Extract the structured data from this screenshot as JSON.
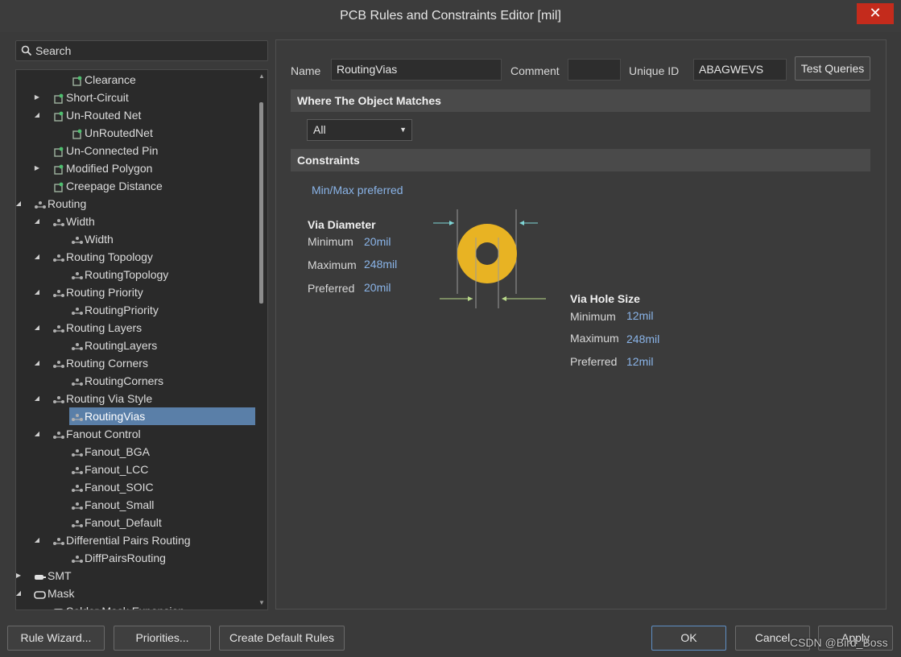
{
  "window": {
    "title": "PCB Rules and Constraints Editor [mil]",
    "close_glyph": "✕"
  },
  "search": {
    "placeholder": "Search"
  },
  "tree": {
    "items": [
      {
        "label": "Clearance",
        "icon": "rule-icon"
      },
      {
        "label": "Short-Circuit",
        "icon": "rule-icon",
        "arrow": "collapsed"
      },
      {
        "label": "Un-Routed Net",
        "icon": "rule-icon",
        "arrow": "expanded"
      },
      {
        "label": "UnRoutedNet",
        "icon": "rule-icon"
      },
      {
        "label": "Un-Connected Pin",
        "icon": "rule-icon"
      },
      {
        "label": "Modified Polygon",
        "icon": "rule-icon",
        "arrow": "collapsed"
      },
      {
        "label": "Creepage Distance",
        "icon": "rule-icon"
      },
      {
        "label": "Routing",
        "icon": "routing-icon",
        "arrow": "expanded"
      },
      {
        "label": "Width",
        "icon": "routing-icon",
        "arrow": "expanded"
      },
      {
        "label": "Width",
        "icon": "routing-icon"
      },
      {
        "label": "Routing Topology",
        "icon": "routing-icon",
        "arrow": "expanded"
      },
      {
        "label": "RoutingTopology",
        "icon": "routing-icon"
      },
      {
        "label": "Routing Priority",
        "icon": "routing-icon",
        "arrow": "expanded"
      },
      {
        "label": "RoutingPriority",
        "icon": "routing-icon"
      },
      {
        "label": "Routing Layers",
        "icon": "routing-icon",
        "arrow": "expanded"
      },
      {
        "label": "RoutingLayers",
        "icon": "routing-icon"
      },
      {
        "label": "Routing Corners",
        "icon": "routing-icon",
        "arrow": "expanded"
      },
      {
        "label": "RoutingCorners",
        "icon": "routing-icon"
      },
      {
        "label": "Routing Via Style",
        "icon": "routing-icon",
        "arrow": "expanded"
      },
      {
        "label": "RoutingVias",
        "icon": "routing-icon",
        "selected": true
      },
      {
        "label": "Fanout Control",
        "icon": "routing-icon",
        "arrow": "expanded"
      },
      {
        "label": "Fanout_BGA",
        "icon": "routing-icon"
      },
      {
        "label": "Fanout_LCC",
        "icon": "routing-icon"
      },
      {
        "label": "Fanout_SOIC",
        "icon": "routing-icon"
      },
      {
        "label": "Fanout_Small",
        "icon": "routing-icon"
      },
      {
        "label": "Fanout_Default",
        "icon": "routing-icon"
      },
      {
        "label": "Differential Pairs Routing",
        "icon": "routing-icon",
        "arrow": "expanded"
      },
      {
        "label": "DiffPairsRouting",
        "icon": "routing-icon"
      },
      {
        "label": "SMT",
        "icon": "smt-icon",
        "arrow": "collapsed"
      },
      {
        "label": "Mask",
        "icon": "mask-icon",
        "arrow": "expanded"
      },
      {
        "label": "Solder Mask Expansion",
        "icon": "mask-icon"
      }
    ]
  },
  "rule": {
    "name_label": "Name",
    "name_value": "RoutingVias",
    "comment_label": "Comment",
    "comment_value": "",
    "uid_label": "Unique ID",
    "uid_value": "ABAGWEVS",
    "test_queries": "Test Queries"
  },
  "match": {
    "header": "Where The Object Matches",
    "selected": "All"
  },
  "constraints": {
    "header": "Constraints",
    "mode": "Min/Max preferred",
    "via_diameter": {
      "title": "Via Diameter",
      "min_label": "Minimum",
      "min": "20mil",
      "max_label": "Maximum",
      "max": "248mil",
      "pref_label": "Preferred",
      "pref": "20mil"
    },
    "via_hole": {
      "title": "Via Hole Size",
      "min_label": "Minimum",
      "min": "12mil",
      "max_label": "Maximum",
      "max": "248mil",
      "pref_label": "Preferred",
      "pref": "12mil"
    },
    "colors": {
      "via_ring": "#e8b323",
      "diameter_arrow": "#7fd6d6",
      "hole_arrow": "#b9d98a"
    }
  },
  "footer": {
    "rule_wizard": "Rule Wizard...",
    "priorities": "Priorities...",
    "create_default": "Create Default Rules",
    "ok": "OK",
    "cancel": "Cancel",
    "apply": "Apply"
  },
  "watermark": "CSDN @Bird_Boss"
}
